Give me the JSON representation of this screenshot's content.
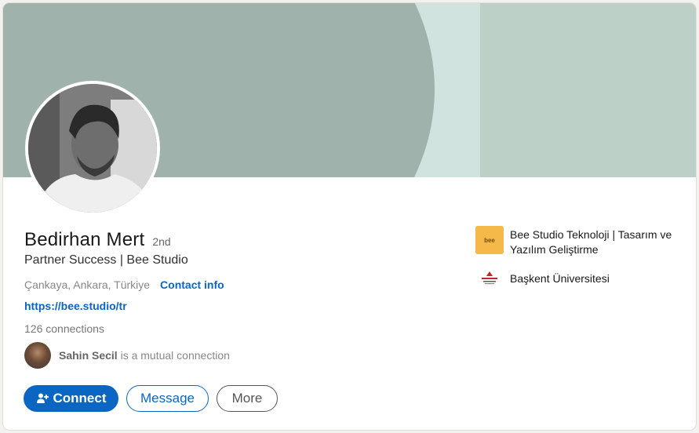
{
  "profile": {
    "name": "Bedirhan Mert",
    "degree": "2nd",
    "headline": "Partner Success | Bee Studio",
    "location": "Çankaya, Ankara, Türkiye",
    "contact_info": "Contact info",
    "website": "https://bee.studio/tr",
    "connections": "126 connections",
    "mutual": {
      "name": "Sahin Secil",
      "suffix": " is a mutual connection"
    }
  },
  "actions": {
    "connect": "Connect",
    "message": "Message",
    "more": "More"
  },
  "sidebar": {
    "items": [
      {
        "label": "Bee Studio Teknoloji | Tasarım ve Yazılım Geliştirme",
        "logo_text": "bee"
      },
      {
        "label": "Başkent Üniversitesi"
      }
    ]
  },
  "colors": {
    "accent": "#0a66c2",
    "banner_dark": "#9fb3ac",
    "banner_light": "#d1e3de",
    "banner_right": "#bcd0c8",
    "logo_bee": "#f5b94a"
  }
}
